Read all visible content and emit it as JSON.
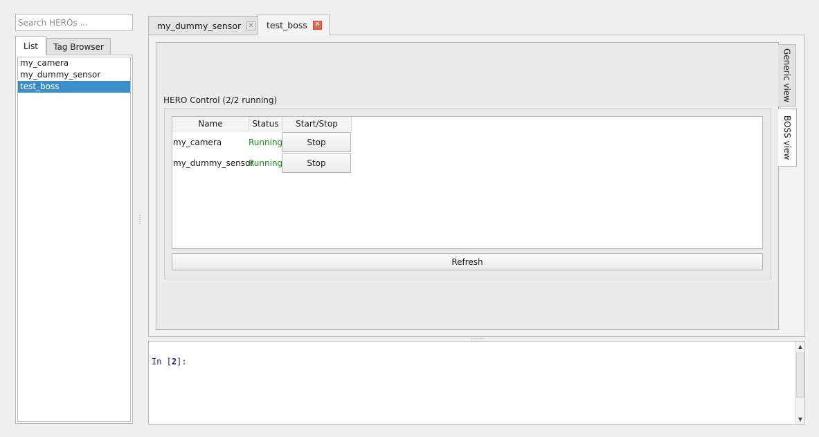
{
  "sidebar": {
    "search_placeholder": "Search HEROs ...",
    "tabs": {
      "list": "List",
      "tag_browser": "Tag Browser"
    },
    "items": [
      "my_camera",
      "my_dummy_sensor",
      "test_boss"
    ],
    "selected": "test_boss"
  },
  "main_tabs": [
    {
      "label": "my_dummy_sensor",
      "close": "✕"
    },
    {
      "label": "test_boss",
      "close": "✕"
    }
  ],
  "side_tabs": {
    "generic": "Generic view",
    "boss": "BOSS view"
  },
  "hero_control": {
    "title": "HERO Control (2/2 running)",
    "columns": [
      "Name",
      "Status",
      "Start/Stop"
    ],
    "rows": [
      {
        "name": "my_camera",
        "status": "Running",
        "action": "Stop"
      },
      {
        "name": "my_dummy_sensor",
        "status": "Running",
        "action": "Stop"
      }
    ],
    "refresh_label": "Refresh"
  },
  "console": {
    "prompt_prefix": "In [",
    "prompt_number": "2",
    "prompt_suffix": "]:"
  },
  "colors": {
    "selection": "#3a8fc9",
    "running": "#1f8c1f",
    "close_active": "#e8654a",
    "prompt": "#1a1aa0"
  },
  "icons": {
    "tab_close": "close-icon",
    "scroll_up": "arrow-up-icon",
    "scroll_down": "arrow-down-icon"
  }
}
